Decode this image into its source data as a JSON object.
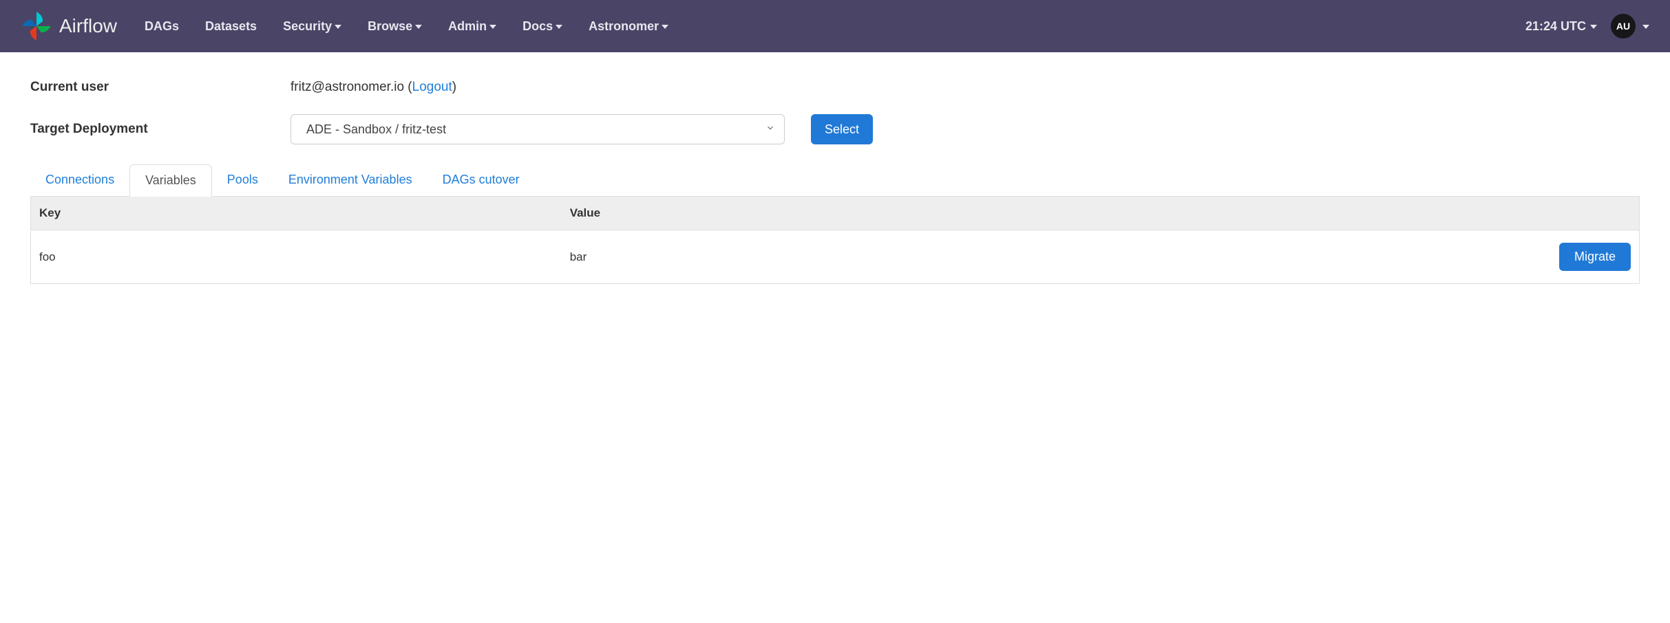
{
  "brand": {
    "name": "Airflow"
  },
  "nav": {
    "items": [
      {
        "label": "DAGs",
        "dropdown": false
      },
      {
        "label": "Datasets",
        "dropdown": false
      },
      {
        "label": "Security",
        "dropdown": true
      },
      {
        "label": "Browse",
        "dropdown": true
      },
      {
        "label": "Admin",
        "dropdown": true
      },
      {
        "label": "Docs",
        "dropdown": true
      },
      {
        "label": "Astronomer",
        "dropdown": true
      }
    ],
    "clock": "21:24 UTC",
    "avatar_initials": "AU"
  },
  "form": {
    "current_user_label": "Current user",
    "current_user_email": "fritz@astronomer.io",
    "logout_label": "Logout",
    "target_deployment_label": "Target Deployment",
    "target_deployment_value": "ADE - Sandbox / fritz-test",
    "select_button": "Select"
  },
  "tabs": {
    "items": [
      {
        "label": "Connections",
        "active": false
      },
      {
        "label": "Variables",
        "active": true
      },
      {
        "label": "Pools",
        "active": false
      },
      {
        "label": "Environment Variables",
        "active": false
      },
      {
        "label": "DAGs cutover",
        "active": false
      }
    ]
  },
  "table": {
    "headers": {
      "key": "Key",
      "value": "Value",
      "action": ""
    },
    "rows": [
      {
        "key": "foo",
        "value": "bar",
        "action": "Migrate"
      }
    ]
  }
}
